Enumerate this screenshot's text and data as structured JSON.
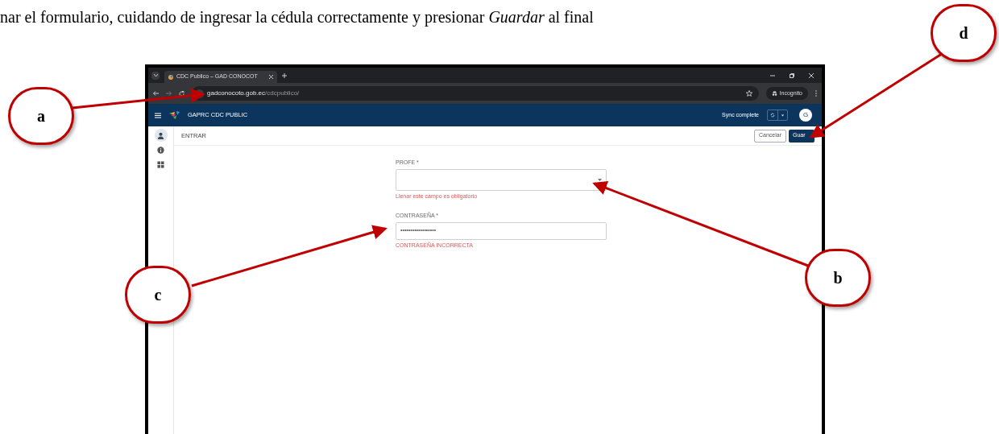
{
  "document": {
    "lines": [
      "nar el formulario, cuidando de ingresar la cédula correctamente y presionar *Guardar* al final"
    ]
  },
  "browser": {
    "tab_title": "CDC Publico – GAD CONOCOT",
    "url_domain": "gadconocoto.gob.ec",
    "url_path": "/cdcpublico/",
    "incognito_label": "Incognito"
  },
  "app": {
    "title": "GAPRC CDC PUBLIC",
    "sync_status": "Sync complete",
    "avatar": "G",
    "sidebar": [
      {
        "kind": "person",
        "selected": true
      },
      {
        "kind": "info",
        "selected": false
      },
      {
        "kind": "grid",
        "selected": false
      }
    ],
    "page_title": "ENTRAR",
    "buttons": [
      {
        "label": "Cancelar",
        "kind": "secondary"
      },
      {
        "label": "Guar",
        "kind": "primary"
      }
    ],
    "fields": [
      {
        "kind": "select",
        "label": "PROFE *",
        "error": "Llenar este campo es obligatorio"
      },
      {
        "kind": "password",
        "label": "CONTRASEÑA *",
        "value": "••••••••••••••••••",
        "error": "CONTRASEÑA INCORRECTA"
      }
    ]
  },
  "annotations": [
    {
      "label": "a"
    },
    {
      "label": "b"
    },
    {
      "label": "c"
    },
    {
      "label": "d"
    }
  ]
}
